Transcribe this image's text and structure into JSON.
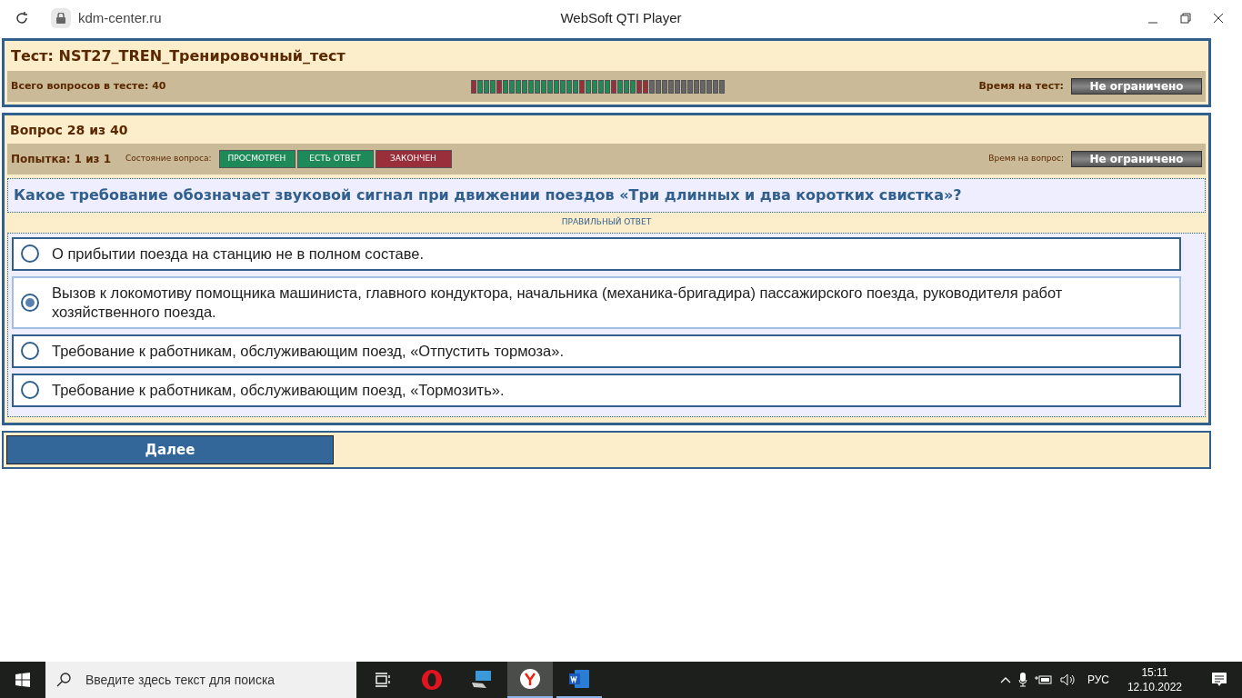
{
  "browser": {
    "address": "kdm-center.ru",
    "title": "WebSoft QTI Player"
  },
  "test": {
    "title": "Тест: NST27_TREN_Тренировочный_тест",
    "total_label": "Всего вопросов в тесте: 40",
    "time_label": "Время на тест:",
    "time_value": "Не ограничено",
    "progress": [
      {
        "color": "#9a2f3c"
      },
      {
        "color": "#1e8a5a"
      },
      {
        "color": "#1e8a5a"
      },
      {
        "color": "#1e8a5a"
      },
      {
        "color": "#9a2f3c"
      },
      {
        "color": "#1e8a5a"
      },
      {
        "color": "#1e8a5a"
      },
      {
        "color": "#1e8a5a"
      },
      {
        "color": "#1e8a5a"
      },
      {
        "color": "#1e8a5a"
      },
      {
        "color": "#1e8a5a"
      },
      {
        "color": "#1e8a5a"
      },
      {
        "color": "#1e8a5a"
      },
      {
        "color": "#1e8a5a"
      },
      {
        "color": "#1e8a5a"
      },
      {
        "color": "#1e8a5a"
      },
      {
        "color": "#1e8a5a"
      },
      {
        "color": "#9a2f3c"
      },
      {
        "color": "#1e8a5a"
      },
      {
        "color": "#1e8a5a"
      },
      {
        "color": "#1e8a5a"
      },
      {
        "color": "#1e8a5a"
      },
      {
        "color": "#9a2f3c"
      },
      {
        "color": "#1e8a5a"
      },
      {
        "color": "#1e8a5a"
      },
      {
        "color": "#1e8a5a"
      },
      {
        "color": "#9a2f3c"
      },
      {
        "color": "#9a2f3c"
      },
      {
        "color": "#666666"
      },
      {
        "color": "#666666"
      },
      {
        "color": "#666666"
      },
      {
        "color": "#666666"
      },
      {
        "color": "#666666"
      },
      {
        "color": "#666666"
      },
      {
        "color": "#666666"
      },
      {
        "color": "#666666"
      },
      {
        "color": "#666666"
      },
      {
        "color": "#666666"
      },
      {
        "color": "#666666"
      },
      {
        "color": "#666666"
      }
    ]
  },
  "question": {
    "title": "Вопрос 28 из 40",
    "attempt": "Попытка: 1 из 1",
    "state_label": "Состояние вопроса:",
    "states": [
      {
        "label": "ПРОСМОТРЕН",
        "color": "#1e8a5a"
      },
      {
        "label": "ЕСТЬ ОТВЕТ",
        "color": "#1e8a5a"
      },
      {
        "label": "ЗАКОНЧЕН",
        "color": "#9a2f3c"
      }
    ],
    "time_label": "Время на вопрос:",
    "time_value": "Не ограничено",
    "text": "Какое требование обозначает звуковой сигнал при движении поездов «Три длинных и два коротких свистка»?",
    "hint": "ПРАВИЛЬНЫЙ ОТВЕТ",
    "options": [
      {
        "text": "О прибытии поезда на станцию не в полном составе.",
        "selected": false
      },
      {
        "text": "Вызов к локомотиву помощника машиниста, главного кондуктора, начальника (механика-бригадира) пассажирского поезда, руководителя работ хозяйственного поезда.",
        "selected": true
      },
      {
        "text": "Требование к работникам, обслуживающим поезд, «Отпустить тормоза».",
        "selected": false
      },
      {
        "text": "Требование к работникам, обслуживающим поезд, «Тормозить».",
        "selected": false
      }
    ]
  },
  "next_button": "Далее",
  "taskbar": {
    "search_placeholder": "Введите здесь текст для поиска",
    "language": "РУС",
    "time": "15:11",
    "date": "12.10.2022"
  }
}
